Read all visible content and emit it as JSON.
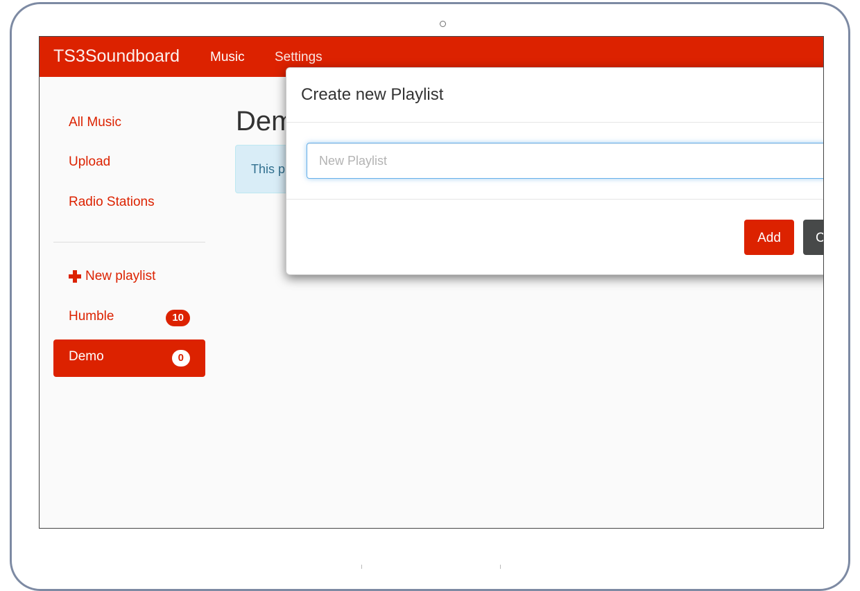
{
  "navbar": {
    "brand": "TS3Soundboard",
    "links": [
      {
        "label": "Music",
        "active": true
      },
      {
        "label": "Settings",
        "active": false
      }
    ]
  },
  "sidebar": {
    "nav_items": [
      {
        "label": "All Music"
      },
      {
        "label": "Upload"
      },
      {
        "label": "Radio Stations"
      }
    ],
    "new_playlist_label": "New playlist",
    "playlists": [
      {
        "label": "Humble",
        "count": "10",
        "active": false
      },
      {
        "label": "Demo",
        "count": "0",
        "active": true
      }
    ]
  },
  "main": {
    "title": "Dem",
    "info_text": "This p"
  },
  "modal": {
    "title": "Create new Playlist",
    "input_placeholder": "New Playlist",
    "input_value": "",
    "add_label": "Add",
    "cancel_label": "C"
  },
  "colors": {
    "primary": "#dc2200",
    "info_bg": "#d9edf7",
    "info_text": "#31708f",
    "cancel_bg": "#474949",
    "device_frame": "#7d8aa3"
  }
}
